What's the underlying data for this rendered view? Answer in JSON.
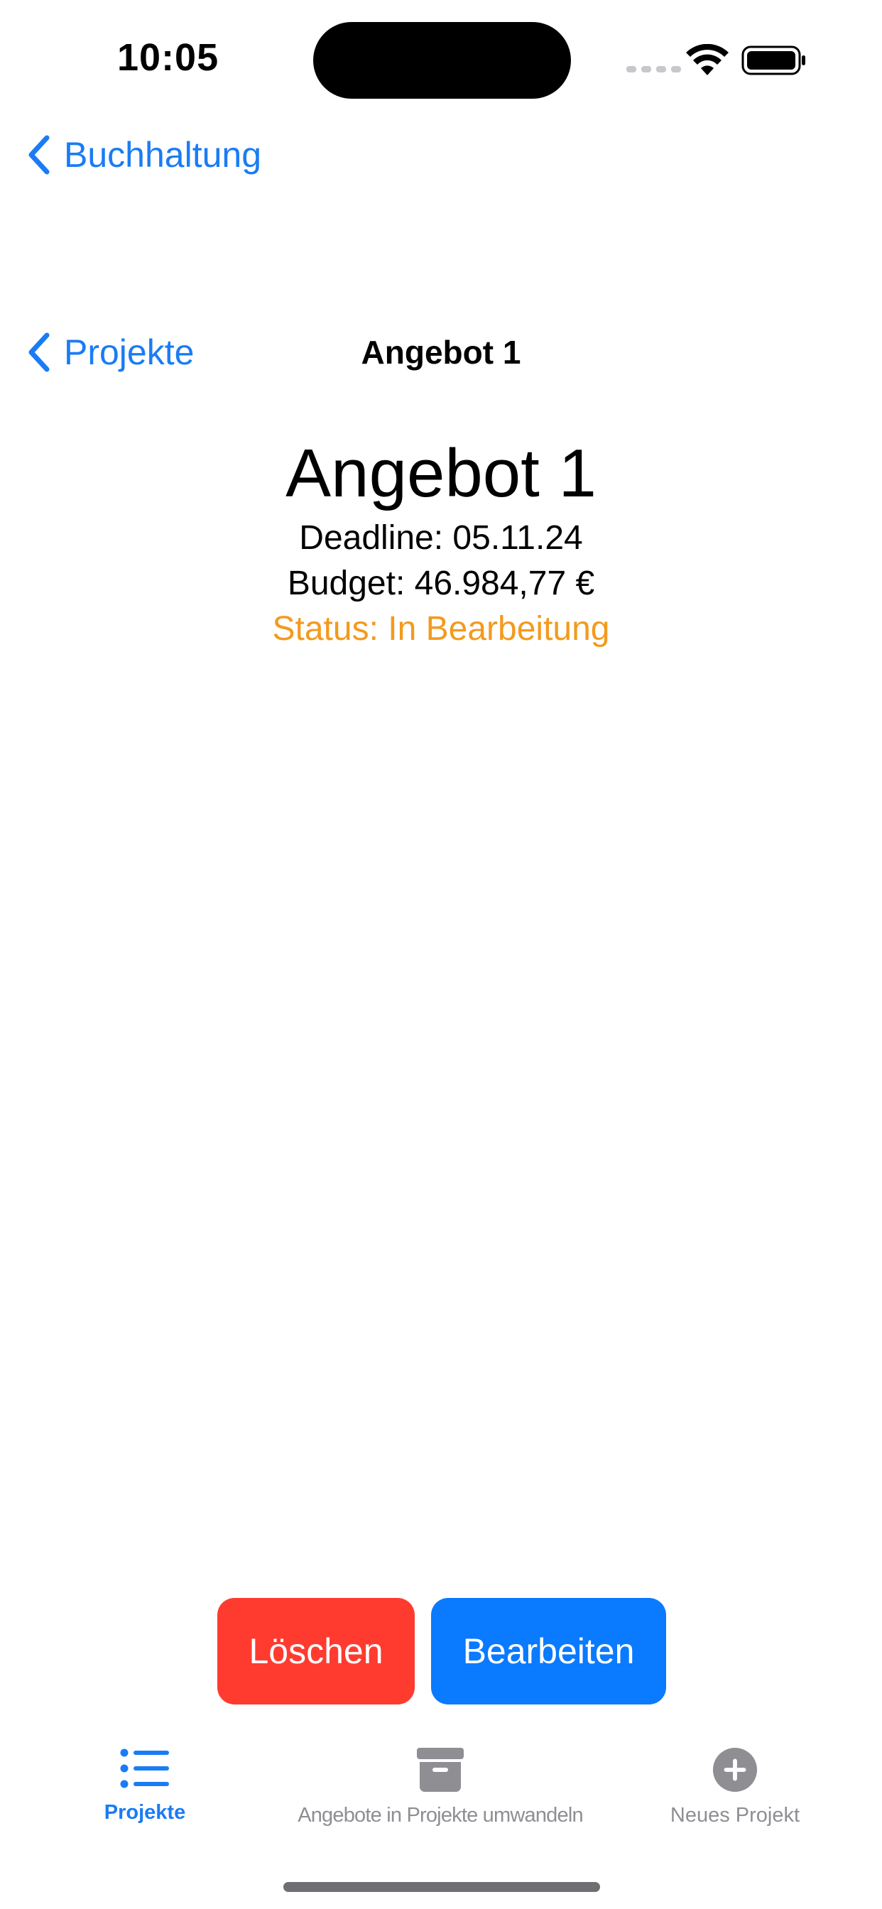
{
  "status_bar": {
    "time": "10:05",
    "icons": [
      "cellular-signal-icon",
      "wifi-icon",
      "battery-icon"
    ]
  },
  "nav": {
    "back_top_label": "Buchhaltung",
    "back_second_label": "Projekte",
    "title": "Angebot 1"
  },
  "detail": {
    "title": "Angebot 1",
    "deadline": "Deadline: 05.11.24",
    "budget": "Budget: 46.984,77 €",
    "status": "Status: In Bearbeitung"
  },
  "actions": {
    "delete_label": "Löschen",
    "edit_label": "Bearbeiten"
  },
  "tabs": [
    {
      "label": "Projekte",
      "icon": "list-bullet-icon",
      "selected": true
    },
    {
      "label": "Angebote in Projekte umwandeln",
      "icon": "archive-box-icon",
      "selected": false
    },
    {
      "label": "Neues Projekt",
      "icon": "plus-circle-icon",
      "selected": false
    }
  ],
  "colors": {
    "accent": "#1a7cf5",
    "status_orange": "#f39a1e",
    "delete_red": "#ff3b30",
    "edit_blue": "#0a7aff",
    "inactive_gray": "#8e8e93"
  }
}
